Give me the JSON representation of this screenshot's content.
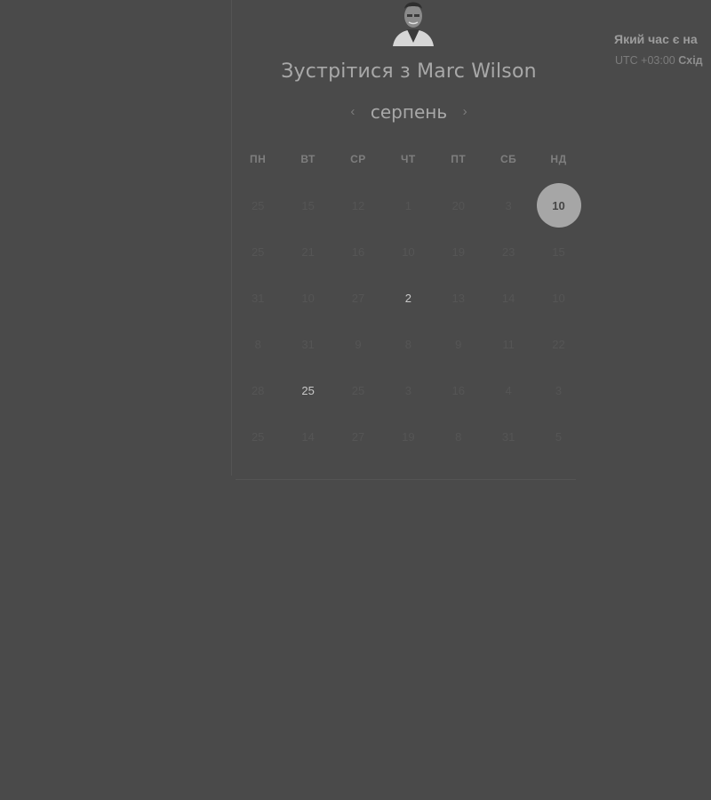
{
  "scheduler": {
    "title": "Зустрітися з Marc Wilson",
    "month": "серпень",
    "prev_icon": "chevron-left-icon",
    "next_icon": "chevron-right-icon",
    "weekdays": [
      "ПН",
      "ВТ",
      "СР",
      "ЧТ",
      "ПТ",
      "СБ",
      "НД"
    ],
    "weeks": [
      [
        "25",
        "15",
        "12",
        "1",
        "20",
        "3",
        "10"
      ],
      [
        "25",
        "21",
        "16",
        "10",
        "19",
        "23",
        "15"
      ],
      [
        "31",
        "10",
        "27",
        "2",
        "13",
        "14",
        "10"
      ],
      [
        "8",
        "31",
        "9",
        "8",
        "9",
        "11",
        "22"
      ],
      [
        "28",
        "25",
        "25",
        "3",
        "16",
        "4",
        "3"
      ],
      [
        "25",
        "14",
        "27",
        "19",
        "8",
        "31",
        "5"
      ]
    ],
    "available_days": [
      "2",
      "25"
    ],
    "selected_day": "10"
  },
  "timezone": {
    "question": "Який час є на",
    "offset": "UTC +03:00",
    "zone": "Схід"
  },
  "colors": {
    "background": "#4a4a4a",
    "selected_circle": "#a6a6a6",
    "available_text": "#c8c8c8",
    "disabled_text": "#555555"
  }
}
